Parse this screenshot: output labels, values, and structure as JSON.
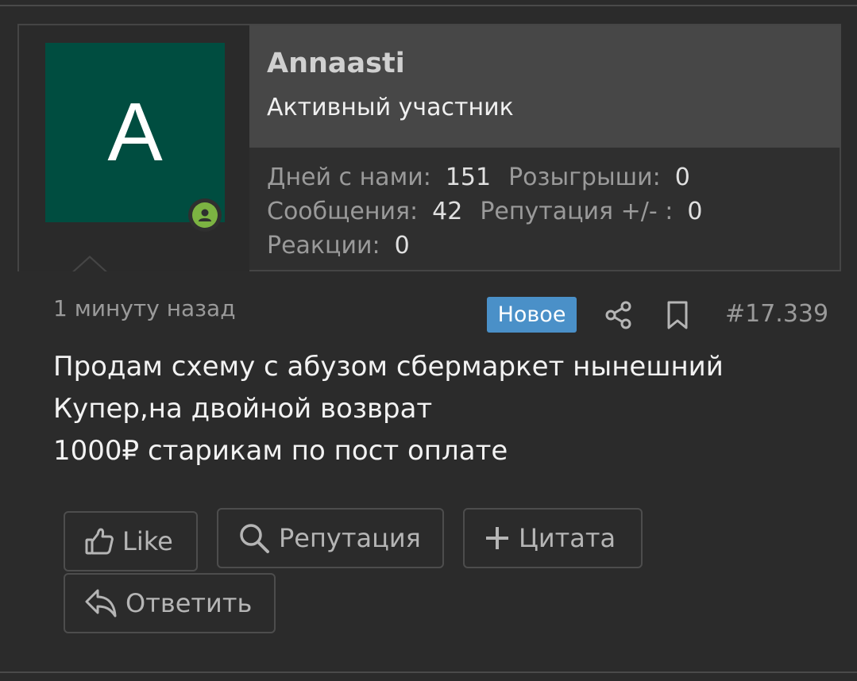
{
  "user": {
    "avatar_letter": "A",
    "name": "Annaasti",
    "title": "Активный участник",
    "stats": {
      "days_label": "Дней с нами:",
      "days_value": "151",
      "giveaways_label": "Розыгрыши:",
      "giveaways_value": "0",
      "messages_label": "Сообщения:",
      "messages_value": "42",
      "reputation_label": "Репутация +/- :",
      "reputation_value": "0",
      "reactions_label": "Реакции:",
      "reactions_value": "0"
    }
  },
  "post": {
    "date": "1 минуту назад",
    "badge": "Новое",
    "number": "#17.339",
    "lines": [
      "Продам схему с абузом сбермаркет нынешний",
      "Купер,на двойной возврат",
      "1000₽ старикам по пост оплате"
    ]
  },
  "actions": {
    "like": "Like",
    "reputation": "Репутация",
    "quote": "Цитата",
    "reply": "Ответить"
  },
  "colors": {
    "background": "#2b2b2b",
    "avatar_bg": "#004d40",
    "badge_bg": "#4a90c8",
    "online": "#7cb342"
  },
  "icons": [
    "user-icon",
    "share-icon",
    "bookmark-icon",
    "thumbs-up-icon",
    "search-icon",
    "plus-icon",
    "reply-icon"
  ]
}
